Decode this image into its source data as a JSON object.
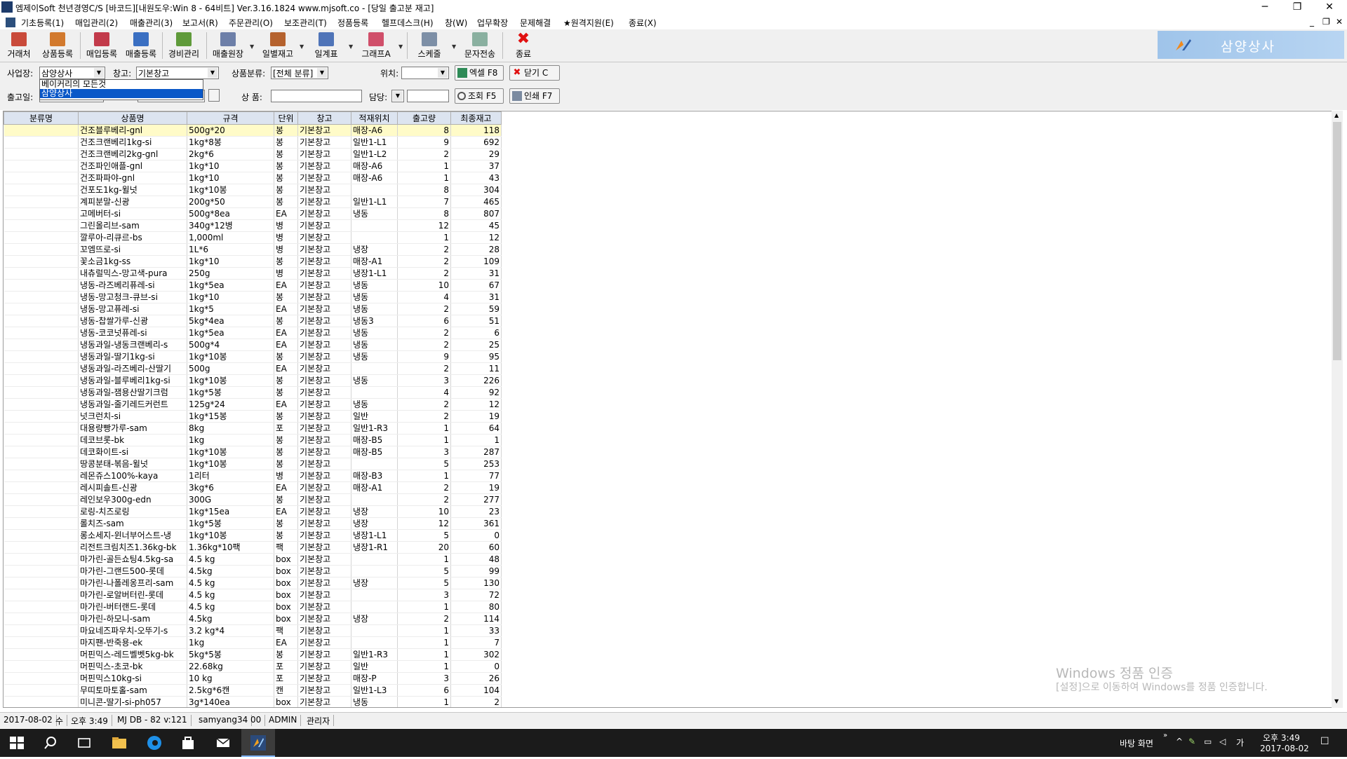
{
  "titlebar": {
    "title": "엠제이Soft 천년경영C/S [바코드][내원도우:Win 8 - 64비트] Ver.3.16.1824          www.mjsoft.co - [당일 출고분 재고]",
    "minimize": "─",
    "maximize": "❐",
    "close": "✕"
  },
  "menubar": {
    "items": [
      "기초등록(1)",
      "매입관리(2)",
      "매출관리(3)",
      "보고서(R)",
      "주문관리(O)",
      "보조관리(T)",
      "정품등록",
      "헬프데스크(H)",
      "창(W)",
      "업무확장",
      "문제해결",
      "★원격지원(E)",
      "종료(X)"
    ],
    "mdi_min": "_",
    "mdi_restore": "❐",
    "mdi_close": "✕"
  },
  "toolbar": {
    "buttons": [
      "거래처",
      "상품등록",
      "매입등록",
      "매출등록",
      "경비관리",
      "매출원장",
      "일별재고",
      "일계표",
      "그래프A",
      "스케줄",
      "문자전송",
      "종료"
    ],
    "brand": "삼양상사"
  },
  "filters": {
    "business_label": "사업장:",
    "business_value": "삼양상사",
    "warehouse_label": "창고:",
    "warehouse_value": "기본창고",
    "category_label": "상품분류:",
    "category_value": "[전체 분류]",
    "location_label": "위치:",
    "location_value": "",
    "excel_button": "엑셀 F8",
    "close_button": "닫기 C",
    "date_label": "출고일:",
    "product_label": "상  품:",
    "staff_label": "담당:",
    "search_button": "조회 F5",
    "print_button": "인쇄 F7",
    "dropdown_options": [
      "베이커리의 모든것",
      "삼양상사"
    ]
  },
  "grid": {
    "columns": [
      "분류명",
      "상품명",
      "규격",
      "단위",
      "창고",
      "적재위치",
      "출고량",
      "최종재고"
    ],
    "rows": [
      [
        "",
        "건조블루베리-gnl",
        "500g*20",
        "봉",
        "기본창고",
        "매장-A6",
        "8",
        "118"
      ],
      [
        "",
        "건조크랜베리1kg-si",
        "1kg*8봉",
        "봉",
        "기본창고",
        "일반1-L1",
        "9",
        "692"
      ],
      [
        "",
        "건조크랜베리2kg-gnl",
        "2kg*6",
        "봉",
        "기본창고",
        "일반1-L2",
        "2",
        "29"
      ],
      [
        "",
        "건조파인애플-gnl",
        "1kg*10",
        "봉",
        "기본창고",
        "매장-A6",
        "1",
        "37"
      ],
      [
        "",
        "건조파파야-gnl",
        "1kg*10",
        "봉",
        "기본창고",
        "매장-A6",
        "1",
        "43"
      ],
      [
        "",
        "건포도1kg-윌넛",
        "1kg*10봉",
        "봉",
        "기본창고",
        "",
        "8",
        "304"
      ],
      [
        "",
        "계피분말-신광",
        "200g*50",
        "봉",
        "기본창고",
        "일반1-L1",
        "7",
        "465"
      ],
      [
        "",
        "고메버터-si",
        "500g*8ea",
        "EA",
        "기본창고",
        "냉동",
        "8",
        "807"
      ],
      [
        "",
        "그린올리브-sam",
        "340g*12병",
        "병",
        "기본창고",
        "",
        "12",
        "45"
      ],
      [
        "",
        "깔루아-리큐르-bs",
        "1,000ml",
        "병",
        "기본창고",
        "",
        "1",
        "12"
      ],
      [
        "",
        "꼬엠뜨로-si",
        "1L*6",
        "병",
        "기본창고",
        "냉장",
        "2",
        "28"
      ],
      [
        "",
        "꽃소금1kg-ss",
        "1kg*10",
        "봉",
        "기본창고",
        "매장-A1",
        "2",
        "109"
      ],
      [
        "",
        "내츄럴믹스-망고색-pura",
        "250g",
        "병",
        "기본창고",
        "냉장1-L1",
        "2",
        "31"
      ],
      [
        "",
        "냉동-라즈베리퓨레-si",
        "1kg*5ea",
        "EA",
        "기본창고",
        "냉동",
        "10",
        "67"
      ],
      [
        "",
        "냉동-망고청크-큐브-si",
        "1kg*10",
        "봉",
        "기본창고",
        "냉동",
        "4",
        "31"
      ],
      [
        "",
        "냉동-망고퓨레-si",
        "1kg*5",
        "EA",
        "기본창고",
        "냉동",
        "2",
        "59"
      ],
      [
        "",
        "냉동-찹쌀가루-신광",
        "5kg*4ea",
        "봉",
        "기본창고",
        "냉동3",
        "6",
        "51"
      ],
      [
        "",
        "냉동-코코넛퓨레-si",
        "1kg*5ea",
        "EA",
        "기본창고",
        "냉동",
        "2",
        "6"
      ],
      [
        "",
        "냉동과일-냉동크랜베리-s",
        "500g*4",
        "EA",
        "기본창고",
        "냉동",
        "2",
        "25"
      ],
      [
        "",
        "냉동과일-딸기1kg-si",
        "1kg*10봉",
        "봉",
        "기본창고",
        "냉동",
        "9",
        "95"
      ],
      [
        "",
        "냉동과일-라즈베리-산딸기",
        "500g",
        "EA",
        "기본창고",
        "",
        "2",
        "11"
      ],
      [
        "",
        "냉동과일-블루베리1kg-si",
        "1kg*10봉",
        "봉",
        "기본창고",
        "냉동",
        "3",
        "226"
      ],
      [
        "",
        "냉동과일-잼용산딸기크럼",
        "1kg*5봉",
        "봉",
        "기본창고",
        "",
        "4",
        "92"
      ],
      [
        "",
        "냉동과일-줄기레드커런트",
        "125g*24",
        "EA",
        "기본창고",
        "냉동",
        "2",
        "12"
      ],
      [
        "",
        "넛크런치-si",
        "1kg*15봉",
        "봉",
        "기본창고",
        "일반",
        "2",
        "19"
      ],
      [
        "",
        "대용량빵가루-sam",
        "8kg",
        "포",
        "기본창고",
        "일반1-R3",
        "1",
        "64"
      ],
      [
        "",
        "데코브롯-bk",
        "1kg",
        "봉",
        "기본창고",
        "매장-B5",
        "1",
        "1"
      ],
      [
        "",
        "데코화이트-si",
        "1kg*10봉",
        "봉",
        "기본창고",
        "매장-B5",
        "3",
        "287"
      ],
      [
        "",
        "땅콩분태-볶음-윌넛",
        "1kg*10봉",
        "봉",
        "기본창고",
        "",
        "5",
        "253"
      ],
      [
        "",
        "레몬쥬스100%-kaya",
        "1리터",
        "병",
        "기본창고",
        "매장-B3",
        "1",
        "77"
      ],
      [
        "",
        "레시피솔트-신광",
        "3kg*6",
        "EA",
        "기본창고",
        "매장-A1",
        "2",
        "19"
      ],
      [
        "",
        "레인보우300g-edn",
        "300G",
        "봉",
        "기본창고",
        "",
        "2",
        "277"
      ],
      [
        "",
        "로링-치즈로링",
        "1kg*15ea",
        "EA",
        "기본창고",
        "냉장",
        "10",
        "23"
      ],
      [
        "",
        "롤치즈-sam",
        "1kg*5봉",
        "봉",
        "기본창고",
        "냉장",
        "12",
        "361"
      ],
      [
        "",
        "롱소세지-윈너부어스트-냉",
        "1kg*10봉",
        "봉",
        "기본창고",
        "냉장1-L1",
        "5",
        "0"
      ],
      [
        "",
        "리전트크림치즈1.36kg-bk",
        "1.36kg*10팩",
        "팩",
        "기본창고",
        "냉장1-R1",
        "20",
        "60"
      ],
      [
        "",
        "마가린-골든쇼팅4.5kg-sa",
        "4.5 kg",
        "box",
        "기본창고",
        "",
        "1",
        "48"
      ],
      [
        "",
        "마가린-그랜드500-롯데",
        "4.5kg",
        "box",
        "기본창고",
        "",
        "5",
        "99"
      ],
      [
        "",
        "마가린-나폴레옹프리-sam",
        "4.5 kg",
        "box",
        "기본창고",
        "냉장",
        "5",
        "130"
      ],
      [
        "",
        "마가린-로알버터린-롯데",
        "4.5  kg",
        "box",
        "기본창고",
        "",
        "3",
        "72"
      ],
      [
        "",
        "마가린-버터랜드-롯데",
        "4.5 kg",
        "box",
        "기본창고",
        "",
        "1",
        "80"
      ],
      [
        "",
        "마가린-하모니-sam",
        "4.5kg",
        "box",
        "기본창고",
        "냉장",
        "2",
        "114"
      ],
      [
        "",
        "마요네즈파우치-오뚜기-s",
        "3.2 kg*4",
        "팩",
        "기본창고",
        "",
        "1",
        "33"
      ],
      [
        "",
        "마지팬-반죽용-ek",
        "1kg",
        "EA",
        "기본창고",
        "",
        "1",
        "7"
      ],
      [
        "",
        "머핀믹스-레드벨벳5kg-bk",
        "5kg*5봉",
        "봉",
        "기본창고",
        "일반1-R3",
        "1",
        "302"
      ],
      [
        "",
        "머핀믹스-초코-bk",
        "22.68kg",
        "포",
        "기본창고",
        "일반",
        "1",
        "0"
      ],
      [
        "",
        "머핀믹스10kg-si",
        "10 kg",
        "포",
        "기본창고",
        "매장-P",
        "3",
        "26"
      ],
      [
        "",
        "무띠토마토홀-sam",
        "2.5kg*6캔",
        "캔",
        "기본창고",
        "일반1-L3",
        "6",
        "104"
      ],
      [
        "",
        "미니콘-딸기-si-ph057",
        "3g*140ea",
        "box",
        "기본창고",
        "냉동",
        "1",
        "2"
      ]
    ]
  },
  "watermark": {
    "line1": "Windows 정품 인증",
    "line2": "[설정]으로 이동하여 Windows를 정품 인증합니다."
  },
  "statusbar": [
    "2017-08-02",
    "수",
    "오후 3:49",
    "MJ DB - 82 v:121",
    "samyang34",
    "00",
    "ADMIN",
    "관리자"
  ],
  "taskbar": {
    "desktop_label": "바탕 화면",
    "ime": "가",
    "time": "오후 3:49",
    "date": "2017-08-02"
  }
}
